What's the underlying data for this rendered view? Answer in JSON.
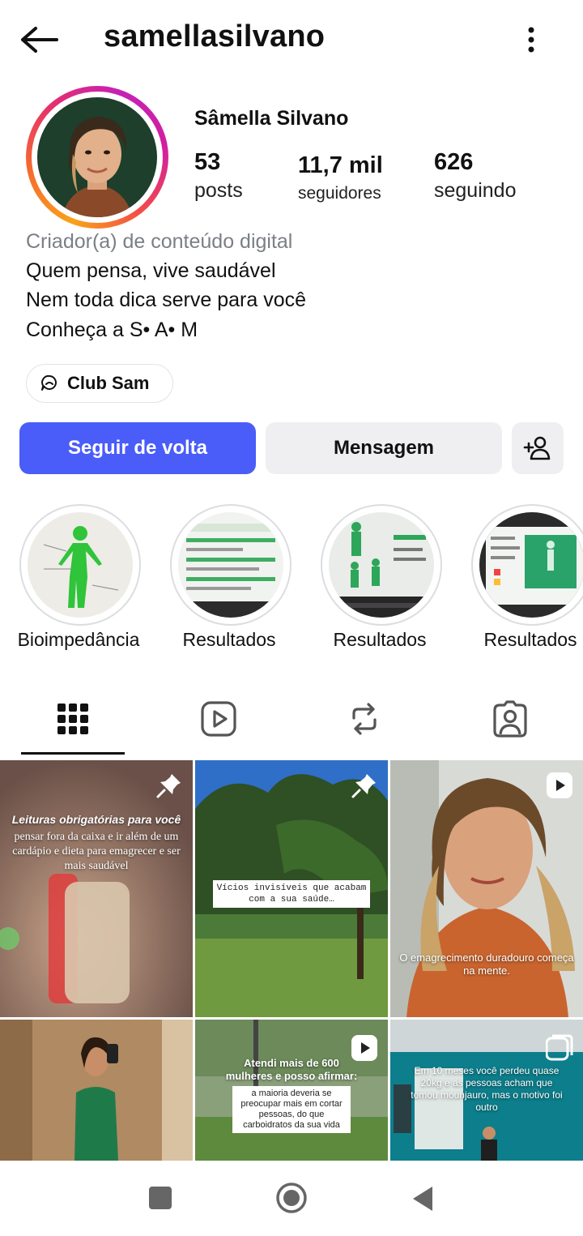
{
  "header": {
    "title": "samellasilvano"
  },
  "profile": {
    "name": "Sâmella Silvano",
    "stats": [
      {
        "value": "53",
        "label": "posts"
      },
      {
        "value": "11,7 mil",
        "label": "seguidores"
      },
      {
        "value": "626",
        "label": "seguindo"
      }
    ],
    "category": "Criador(a) de conteúdo digital",
    "bio": [
      "Quem pensa, vive saudável",
      "Nem toda dica serve para você",
      "Conheça a S• A• M"
    ],
    "link_label": "Club Sam"
  },
  "actions": {
    "follow_back": "Seguir de volta",
    "message": "Mensagem"
  },
  "highlights": [
    {
      "label": "Bioimpedância"
    },
    {
      "label": "Resultados"
    },
    {
      "label": "Resultados"
    },
    {
      "label": "Resultados"
    }
  ],
  "tabs": [
    "grid-icon",
    "reels-icon",
    "reposts-icon",
    "tagged-icon"
  ],
  "posts": [
    {
      "title": "Leituras obrigatórias para você",
      "text": "pensar fora da caixa e ir além de um cardápio e dieta para emagrecer e ser mais saudável",
      "badge": "pin-icon"
    },
    {
      "text": "Vícios invisíveis que acabam com a sua saúde…",
      "badge": "pin-icon"
    },
    {
      "text": "O emagrecimento duradouro começa na mente.",
      "badge": "reel-icon"
    },
    {
      "text": "",
      "badge": "none"
    },
    {
      "title": "Atendi mais de 600 mulheres e posso afirmar:",
      "text": "a maioria deveria se preocupar mais em cortar pessoas, do que carboidratos da sua vida",
      "badge": "reel-icon"
    },
    {
      "text": "Em 10 meses você perdeu quase 20kg e as pessoas acham que tomou mounjauro, mas o motivo foi outro",
      "badge": "carousel-icon"
    }
  ],
  "colors": {
    "accent": "#4a5df9",
    "secondary_button": "#efeff2",
    "muted_text": "#7b7f86"
  }
}
